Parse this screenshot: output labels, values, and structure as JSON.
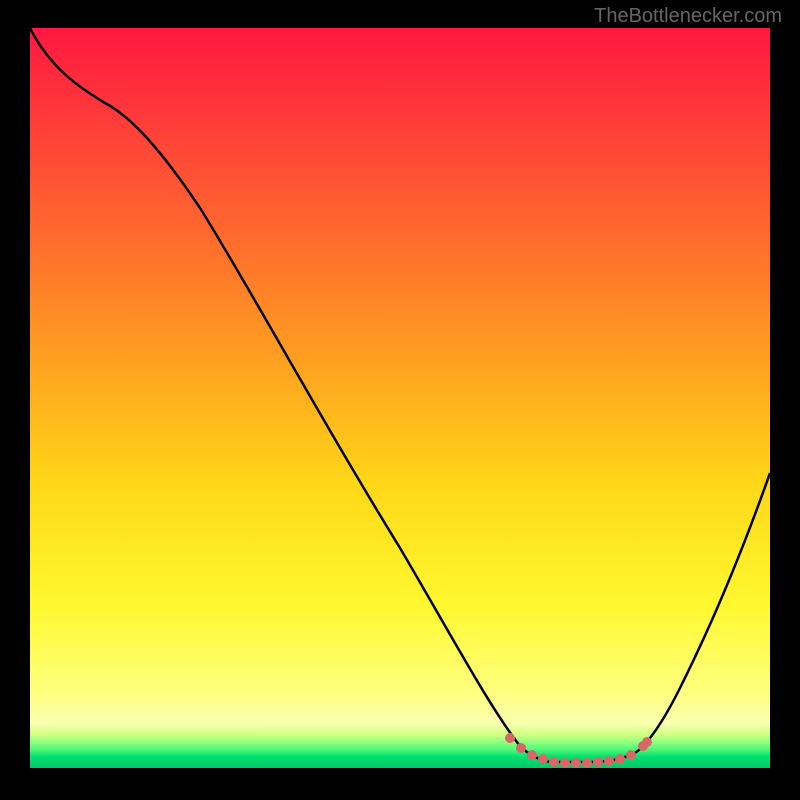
{
  "watermark": "TheBottlenecker.com",
  "chart_data": {
    "type": "line",
    "title": "",
    "xlabel": "",
    "ylabel": "",
    "xlim": [
      0,
      100
    ],
    "ylim": [
      0,
      100
    ],
    "gradient_colors": {
      "top": "#ff1a3a",
      "upper_mid": "#ff7a2a",
      "mid": "#ffd820",
      "lower_mid": "#ffff60",
      "bottom_line1": "#d8ff70",
      "bottom_line2": "#80ff80",
      "bottom_line3": "#00e070",
      "bottom_line4": "#00c060"
    },
    "curve_points": [
      {
        "x": 0,
        "y": 100
      },
      {
        "x": 4,
        "y": 94
      },
      {
        "x": 10,
        "y": 90
      },
      {
        "x": 20,
        "y": 76
      },
      {
        "x": 30,
        "y": 62
      },
      {
        "x": 40,
        "y": 48
      },
      {
        "x": 50,
        "y": 34
      },
      {
        "x": 58,
        "y": 20
      },
      {
        "x": 64,
        "y": 8
      },
      {
        "x": 67,
        "y": 2
      },
      {
        "x": 70,
        "y": 0.5
      },
      {
        "x": 75,
        "y": 0.5
      },
      {
        "x": 80,
        "y": 0.8
      },
      {
        "x": 83,
        "y": 2
      },
      {
        "x": 88,
        "y": 12
      },
      {
        "x": 94,
        "y": 26
      },
      {
        "x": 100,
        "y": 40
      }
    ],
    "dotted_segment": {
      "x_start": 65,
      "x_end": 84,
      "color": "#d86565"
    },
    "annotations": []
  }
}
